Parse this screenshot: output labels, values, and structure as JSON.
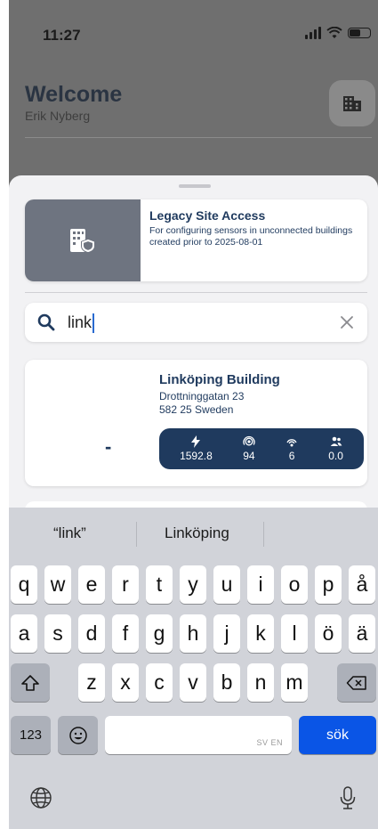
{
  "status_bar": {
    "time": "11:27"
  },
  "header": {
    "title": "Welcome",
    "subtitle": "Erik Nyberg",
    "action_icon": "building-icon"
  },
  "legacy_site": {
    "title": "Legacy Site Access",
    "description": "For configuring sensors in unconnected buildings created prior to 2025-08-01",
    "icon": "building-shield-icon"
  },
  "search": {
    "value": "link",
    "icon": "search-icon",
    "clear_icon": "close-icon"
  },
  "results": [
    {
      "placeholder": "-",
      "name": "Linköping Building",
      "address_line1": "Drottninggatan 23",
      "address_line2": "582 25 Sweden",
      "stats": [
        {
          "icon": "lightning-icon",
          "value": "1592.8"
        },
        {
          "icon": "sensor-icon",
          "value": "94"
        },
        {
          "icon": "gateway-icon",
          "value": "6"
        },
        {
          "icon": "people-icon",
          "value": "0.0"
        }
      ]
    }
  ],
  "keyboard": {
    "suggestions": [
      "“link”",
      "Linköping",
      ""
    ],
    "row1": [
      "q",
      "w",
      "e",
      "r",
      "t",
      "y",
      "u",
      "i",
      "o",
      "p",
      "å"
    ],
    "row2": [
      "a",
      "s",
      "d",
      "f",
      "g",
      "h",
      "j",
      "k",
      "l",
      "ö",
      "ä"
    ],
    "row3": [
      "z",
      "x",
      "c",
      "v",
      "b",
      "n",
      "m"
    ],
    "numbers_key": "123",
    "space_language": "SV EN",
    "return_key": "sök",
    "accent_color": "#0a55e6"
  },
  "colors": {
    "brand_navy": "#1f3a5e",
    "dim_overlay": "#6f6f6f",
    "sheet_bg": "#f2f2f4"
  }
}
